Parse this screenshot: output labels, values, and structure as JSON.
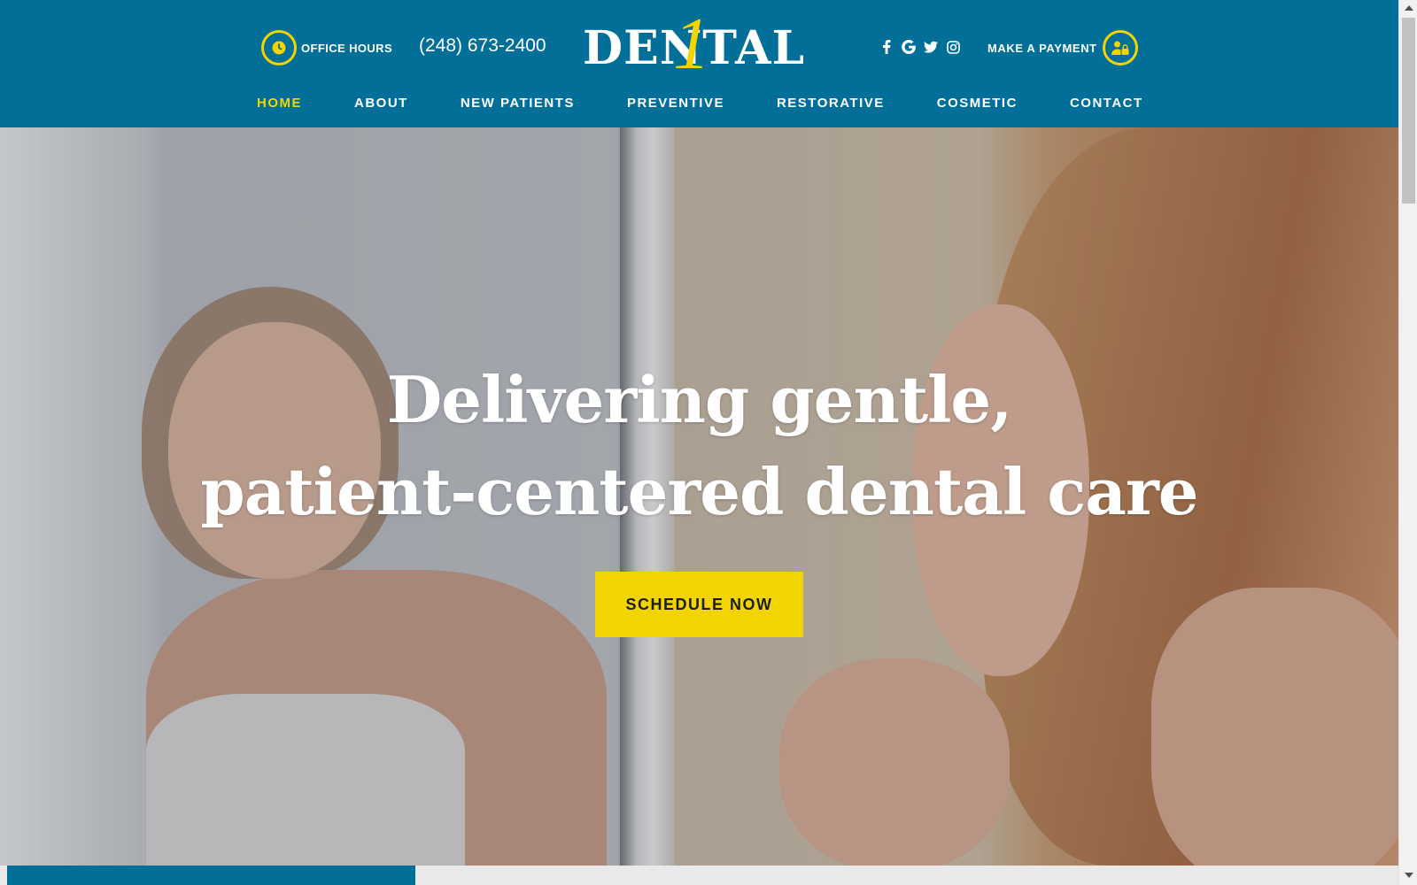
{
  "header": {
    "office_hours_label": "OFFICE HOURS",
    "phone": "(248) 673-2400",
    "logo": {
      "word": "DENTAL",
      "numeral": "1"
    },
    "social_icons": [
      "facebook-icon",
      "google-icon",
      "twitter-icon",
      "instagram-icon"
    ],
    "payment_label": "MAKE A PAYMENT"
  },
  "nav": {
    "items": [
      {
        "label": "HOME",
        "active": true
      },
      {
        "label": "ABOUT",
        "active": false
      },
      {
        "label": "NEW PATIENTS",
        "active": false
      },
      {
        "label": "PREVENTIVE",
        "active": false
      },
      {
        "label": "RESTORATIVE",
        "active": false
      },
      {
        "label": "COSMETIC",
        "active": false
      },
      {
        "label": "CONTACT",
        "active": false
      }
    ]
  },
  "hero": {
    "headline_line1": "Delivering gentle,",
    "headline_line2": "patient-centered dental care",
    "cta_label": "SCHEDULE NOW"
  },
  "colors": {
    "brand_blue": "#016f98",
    "accent_yellow": "#f2d500",
    "text_white": "#ffffff"
  }
}
